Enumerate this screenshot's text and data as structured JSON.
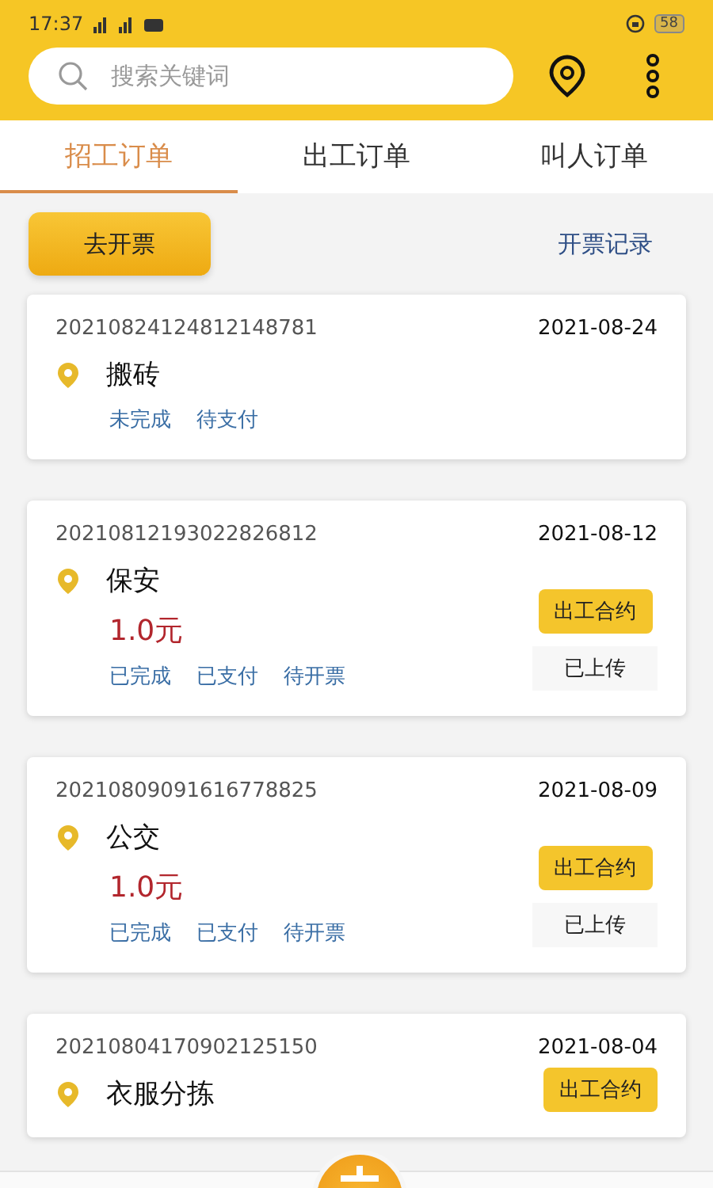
{
  "status_bar": {
    "time": "17:37",
    "battery": "58"
  },
  "search": {
    "placeholder": "搜索关键词"
  },
  "tabs": [
    {
      "label": "招工订单",
      "selected": true
    },
    {
      "label": "出工订单",
      "selected": false
    },
    {
      "label": "叫人订单",
      "selected": false
    }
  ],
  "invoice_button": "去开票",
  "invoice_records_link": "开票记录",
  "orders": [
    {
      "number": "20210824124812148781",
      "date": "2021-08-24",
      "title": "搬砖",
      "statuses": [
        "未完成",
        "待支付"
      ]
    },
    {
      "number": "20210812193022826812",
      "date": "2021-08-12",
      "title": "保安",
      "price": "1.0元",
      "statuses": [
        "已完成",
        "已支付",
        "待开票"
      ],
      "contract_button": "出工合约",
      "upload_status": "已上传"
    },
    {
      "number": "20210809091616778825",
      "date": "2021-08-09",
      "title": "公交",
      "price": "1.0元",
      "statuses": [
        "已完成",
        "已支付",
        "待开票"
      ],
      "contract_button": "出工合约",
      "upload_status": "已上传"
    },
    {
      "number": "20210804170902125150",
      "date": "2021-08-04",
      "title": "衣服分拣",
      "contract_button": "出工合约"
    }
  ]
}
